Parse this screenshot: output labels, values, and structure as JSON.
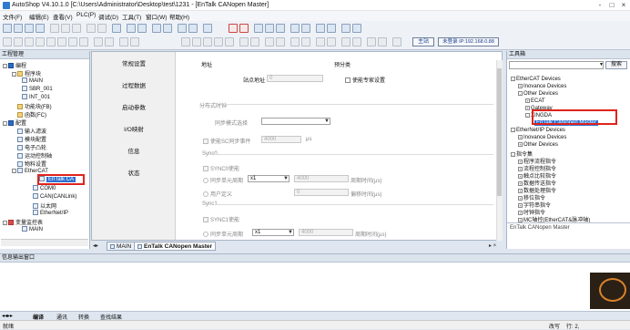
{
  "window": {
    "title": "AutoShop V4.10.1.0 [C:\\Users\\Administrator\\Desktop\\test\\1231 - [EnTalk CANopen Master]",
    "min": "-",
    "max": "□",
    "close": "×"
  },
  "menu": [
    "文件(F)",
    "编辑(E)",
    "查看(V)",
    "PLC(P)",
    "调试(D)",
    "工具(T)",
    "窗口(W)",
    "帮助(H)"
  ],
  "toolbar": {
    "main_label": "主站",
    "ip_label": "未登录 IP:192.168.0.88"
  },
  "left_panel": {
    "title": "工程管理",
    "items": [
      "编程",
      "程序块",
      "MAIN",
      "SBR_001",
      "INT_001",
      "功能块(FB)",
      "函数(FC)",
      "配置",
      "输入滤波",
      "模块配置",
      "电子凸轮",
      "运动控制轴",
      "物料设置",
      "EtherCAT",
      "EnTalk CA",
      "COM0",
      "CAN(CANLink)",
      "以太网",
      "EtherNet/IP",
      "变量监控表",
      "MAIN"
    ]
  },
  "editor": {
    "nav": [
      "常规设置",
      "过程数据",
      "启动参数",
      "I/O映射",
      "信息",
      "状态"
    ],
    "fields": {
      "address_section": "地址",
      "node_addr_label": "站点地址",
      "node_addr_value": "0",
      "expert_label": "预分类",
      "expert_check_label": "使能专家设置",
      "dist_clock_section": "分布式时钟",
      "sync_mode_label": "同步模式选择",
      "sync_mode_value": "",
      "sync_events_label": "使能SC同步事件",
      "sync_events_value": "4000",
      "sync_events_unit": "μs",
      "sync0_section": "Sync0",
      "sync0_enable": "SYNC0使能",
      "sync_unit_label": "同步单元周期",
      "sync_unit_value": "x1",
      "sync_unit_num": "4000",
      "cycle_label": "周期时间(μs)",
      "user_def_label": "用户定义",
      "user_def_value": "0",
      "offset_label": "偏移时间(μs)",
      "sync1_section": "Sync1",
      "sync1_enable": "SYNC1使能",
      "sync1_unit_label": "同步单元周期",
      "sync1_unit_value": "x1",
      "sync1_unit_num": "4000",
      "sync1_cycle_label": "周期时间(μs)"
    }
  },
  "tabs": {
    "tab1": "MAIN",
    "tab2": "EnTalk CANopen Master"
  },
  "right_panel": {
    "title": "工具箱",
    "search_button": "搜索",
    "items": [
      "EtherCAT Devices",
      "Inovance Devices",
      "Other Devices",
      "ECAT",
      "Gateway",
      "XINGDA",
      "EnTalk CANopen Master",
      "EtherNet/IP Devices",
      "Inovance Devices",
      "Other Devices",
      "指令集",
      "程序流程指令",
      "流程控制指令",
      "触点比较指令",
      "数据传送指令",
      "数据处理指令",
      "移位指令",
      "字符串指令",
      "时钟指令",
      "MC轴控(EtherCAT&脉冲轴)"
    ],
    "footer": "EnTalk CANopen Master"
  },
  "output": {
    "title": "信息输出窗口",
    "tabs": [
      "编译",
      "通讯",
      "转换",
      "查找结果"
    ]
  },
  "status": {
    "left": "就绪",
    "mid": "改写",
    "right": "行: 2,"
  }
}
